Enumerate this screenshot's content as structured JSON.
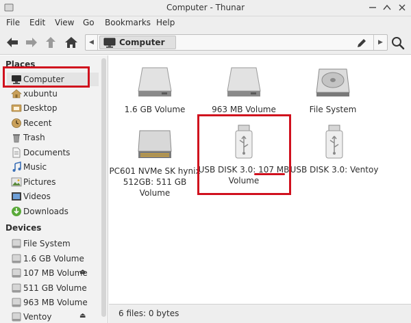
{
  "window": {
    "title": "Computer - Thunar"
  },
  "menu": [
    "File",
    "Edit",
    "View",
    "Go",
    "Bookmarks",
    "Help"
  ],
  "toolbar": {
    "location_label": "Computer",
    "icons": [
      "back-arrow-icon",
      "forward-arrow-icon",
      "up-arrow-icon",
      "home-icon",
      "edit-pencil-icon",
      "search-icon"
    ]
  },
  "sidebar": {
    "places_title": "Places",
    "places": [
      {
        "label": "Computer",
        "icon": "monitor-icon"
      },
      {
        "label": "xubuntu",
        "icon": "home-folder-icon"
      },
      {
        "label": "Desktop",
        "icon": "desktop-folder-icon"
      },
      {
        "label": "Recent",
        "icon": "clock-icon"
      },
      {
        "label": "Trash",
        "icon": "trash-icon"
      },
      {
        "label": "Documents",
        "icon": "documents-icon"
      },
      {
        "label": "Music",
        "icon": "music-icon"
      },
      {
        "label": "Pictures",
        "icon": "pictures-icon"
      },
      {
        "label": "Videos",
        "icon": "videos-icon"
      },
      {
        "label": "Downloads",
        "icon": "download-icon"
      }
    ],
    "devices_title": "Devices",
    "devices": [
      {
        "label": "File System",
        "icon": "drive-icon"
      },
      {
        "label": "1.6 GB Volume",
        "icon": "drive-icon"
      },
      {
        "label": "107 MB Volume",
        "icon": "drive-icon"
      },
      {
        "label": "511 GB Volume",
        "icon": "drive-icon"
      },
      {
        "label": "963 MB Volume",
        "icon": "drive-icon"
      },
      {
        "label": "Ventoy",
        "icon": "drive-icon"
      }
    ]
  },
  "files": [
    {
      "label": "1.6 GB Volume",
      "icon": "hard-drive-icon"
    },
    {
      "label": "963 MB Volume",
      "icon": "hard-drive-icon"
    },
    {
      "label": "File System",
      "icon": "system-drive-icon"
    },
    {
      "label": "PC601 NVMe SK hynix 512GB: 511 GB Volume",
      "icon": "nvme-drive-icon"
    },
    {
      "label_pre": "USB DISK 3.0: ",
      "label_size": "107 MB",
      "label_post": " Volume",
      "icon": "usb-stick-icon"
    },
    {
      "label": "USB DISK 3.0: Ventoy",
      "icon": "usb-stick-icon"
    }
  ],
  "status": {
    "text": "6 files: 0 bytes"
  },
  "colors": {
    "annotation": "#d0101d",
    "accent": "#4a90d9"
  }
}
